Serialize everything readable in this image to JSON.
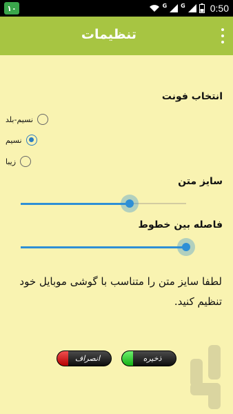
{
  "status_bar": {
    "notification_count": "۱۰",
    "net1": "G",
    "net2": "G",
    "time": "0:50"
  },
  "app_bar": {
    "title": "تنظیمات"
  },
  "font_section": {
    "label": "انتخاب فونت",
    "options": [
      {
        "label": "نسیم-بلد",
        "checked": false
      },
      {
        "label": "نسیم",
        "checked": true
      },
      {
        "label": "زیبا",
        "checked": false
      }
    ]
  },
  "text_size": {
    "label": "سایز متن",
    "value_percent": 66
  },
  "line_spacing": {
    "label": "فاصله بین خطوط",
    "value_percent": 100
  },
  "hint": "لطفا سایز متن را متناسب با گوشی موبایل خود تنظیم کنید.",
  "buttons": {
    "cancel_label": "انصراف",
    "save_label": "ذخیره"
  },
  "colors": {
    "background": "#f9f3b1",
    "app_bar": "#a7c542",
    "accent": "#2e8fd6"
  }
}
